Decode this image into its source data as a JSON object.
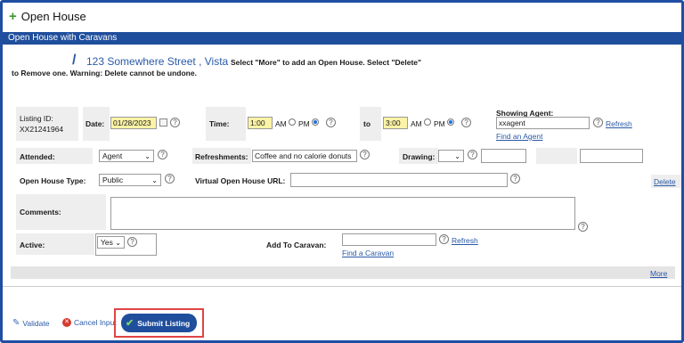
{
  "window": {
    "title": "Open House"
  },
  "section_bar": "Open House with Caravans",
  "header": {
    "address": "123 Somewhere Street , Vista",
    "instruction_1": "Select \"More\" to add an Open House.  Select \"Delete\"",
    "instruction_2": "to Remove one.  Warning: Delete cannot be undone."
  },
  "form": {
    "listing_id_label": "Listing ID:",
    "listing_id_value": "XX21241964",
    "date_label": "Date:",
    "date_value": "01/28/2023",
    "time_label": "Time:",
    "time_from": "1:00",
    "to_label": "to",
    "time_to": "3:00",
    "am": "AM",
    "pm": "PM",
    "showing_agent_label": "Showing Agent:",
    "showing_agent_value": "xxagent",
    "refresh": "Refresh",
    "find_agent": "Find an Agent",
    "attended_label": "Attended:",
    "attended_value": "Agent",
    "refreshments_label": "Refreshments:",
    "refreshments_value": "Coffee and no calorie donuts",
    "drawing_label": "Drawing:",
    "drawing_value": "",
    "open_house_type_label": "Open House Type:",
    "open_house_type_value": "Public",
    "virtual_url_label": "Virtual Open House URL:",
    "virtual_url_value": "",
    "delete": "Delete",
    "comments_label": "Comments:",
    "comments_value": "",
    "active_label": "Active:",
    "active_value": "Yes",
    "add_to_caravan_label": "Add To Caravan:",
    "caravan_value": "",
    "caravan_refresh": "Refresh",
    "find_caravan": "Find a Caravan",
    "more": "More"
  },
  "footer": {
    "validate": "Validate",
    "cancel_input": "Cancel Input",
    "submit_listing": "Submit Listing"
  },
  "colors": {
    "brand_blue": "#1f4e9c",
    "highlight_red": "#e04444",
    "field_yellow": "#fbf3a6"
  }
}
